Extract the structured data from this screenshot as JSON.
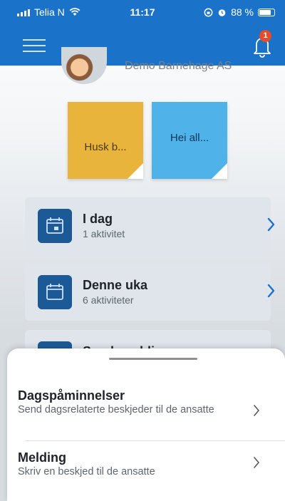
{
  "status_bar": {
    "carrier": "Telia N",
    "time": "11:17",
    "battery": "88 %"
  },
  "header": {
    "notification_count": "1"
  },
  "profile": {
    "organization": "Demo Barnehage AS"
  },
  "notes": [
    {
      "text": "Husk b...",
      "color": "#e8b43c"
    },
    {
      "text": "Hei all...",
      "color": "#4fb3ea"
    }
  ],
  "activities": [
    {
      "title": "I dag",
      "subtitle": "1 aktivitet"
    },
    {
      "title": "Denne uka",
      "subtitle": "6 aktiviteter"
    },
    {
      "title": "Sendemeldinger"
    }
  ],
  "sheet": {
    "items": [
      {
        "title": "Dagspåminnelser",
        "subtitle": "Send dagsrelaterte beskjeder til de ansatte"
      },
      {
        "title": "Melding",
        "subtitle": "Skriv en beskjed til de ansatte"
      }
    ]
  },
  "colors": {
    "brand": "#1b73c9",
    "icon_tile": "#1b5a96",
    "badge": "#e74b2a"
  }
}
